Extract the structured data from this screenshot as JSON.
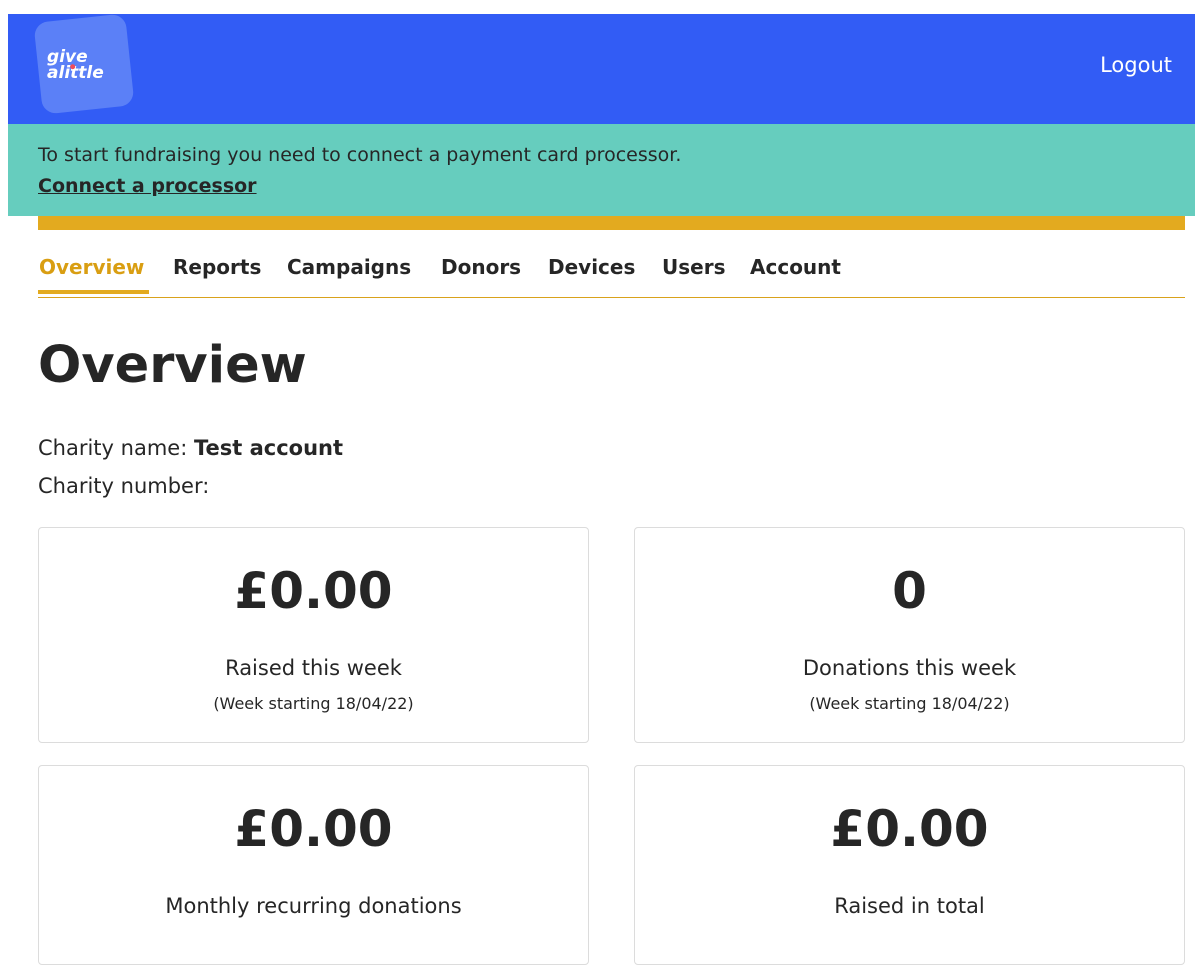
{
  "header": {
    "logo_text": "give a little",
    "logout_label": "Logout"
  },
  "banner": {
    "message": "To start fundraising you need to connect a payment card processor.",
    "link_label": "Connect a processor"
  },
  "nav": {
    "tabs": [
      {
        "label": "Overview",
        "active": true
      },
      {
        "label": "Reports",
        "active": false
      },
      {
        "label": "Campaigns",
        "active": false
      },
      {
        "label": "Donors",
        "active": false
      },
      {
        "label": "Devices",
        "active": false
      },
      {
        "label": "Users",
        "active": false
      },
      {
        "label": "Account",
        "active": false
      }
    ]
  },
  "main": {
    "title": "Overview",
    "charity_name_label": "Charity name:",
    "charity_name_value": "Test account",
    "charity_number_label": "Charity number:",
    "charity_number_value": ""
  },
  "stats": [
    {
      "value": "£0.00",
      "label": "Raised this week",
      "sub": "(Week starting 18/04/22)"
    },
    {
      "value": "0",
      "label": "Donations this week",
      "sub": "(Week starting 18/04/22)"
    },
    {
      "value": "£0.00",
      "label": "Monthly recurring donations",
      "sub": ""
    },
    {
      "value": "£0.00",
      "label": "Raised in total",
      "sub": ""
    }
  ],
  "colors": {
    "header_bg": "#325cf5",
    "banner_bg": "#66cdbe",
    "accent_gold": "#e3aa1f",
    "active_tab": "#d99e12",
    "text": "#262626"
  }
}
